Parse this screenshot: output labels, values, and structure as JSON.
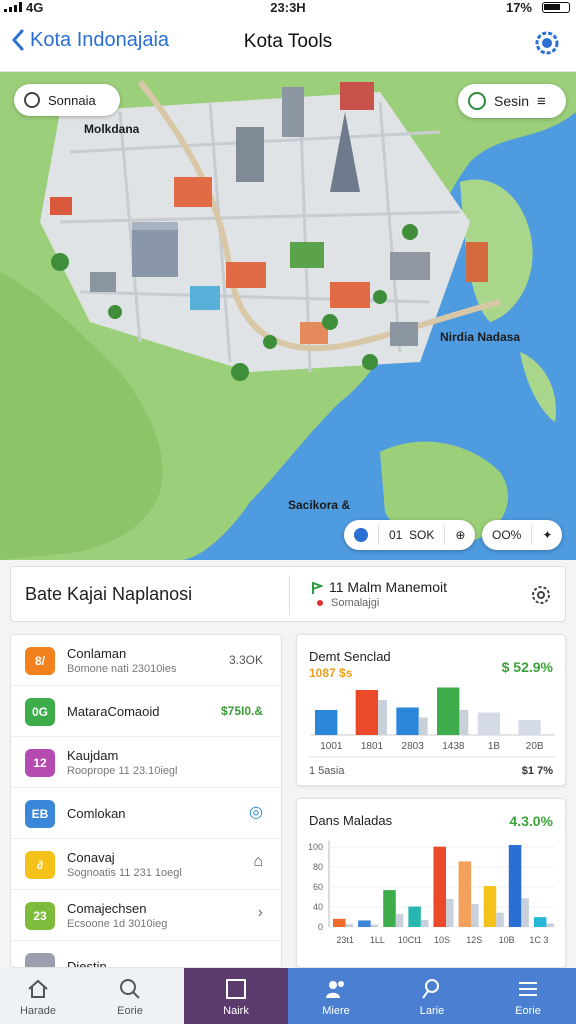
{
  "status": {
    "left": "4G",
    "time": "23:3H",
    "right": "17%"
  },
  "header": {
    "back_label": "Kota Indonajaia",
    "title": "Kota Tools"
  },
  "map": {
    "search_chip": "Sonnaia",
    "session_chip": "Sesin",
    "labels": {
      "north_west": "Molkdana",
      "east": "Nirdia Nadasa",
      "south": "Sacikora &"
    },
    "controls": {
      "count": "01",
      "unit": "SOK",
      "zoom": "OO%"
    }
  },
  "summary": {
    "title": "Bate Kajai Naplanosi",
    "metric": "11 Malm Manemoit",
    "metric_sub": "Somalajgi"
  },
  "list": [
    {
      "badge": "8/",
      "color": "#f2811d",
      "name": "Conlaman",
      "sub": "Bomone nati 23010ies",
      "value": "3.3OK"
    },
    {
      "badge": "0G",
      "color": "#3cad4a",
      "name": "MataraComaoid",
      "sub": "",
      "value": "$75I0.&",
      "value_color": "#3a9a3a"
    },
    {
      "badge": "12",
      "color": "#b54bb0",
      "name": "Kaujdam",
      "sub": "Rooprope 11 23.10iegl",
      "value": ""
    },
    {
      "badge": "EB",
      "color": "#3a86d8",
      "name": "Comlokan",
      "sub": "",
      "value": ""
    },
    {
      "badge": "∂",
      "color": "#f5c21b",
      "name": "Conavaj",
      "sub": "Sognoatis 11 231 1oegl",
      "value": ""
    },
    {
      "badge": "23",
      "color": "#7cbb3b",
      "name": "Comajechsen",
      "sub": "Ecsoone 1d 3010ieg",
      "value": ""
    },
    {
      "badge": "",
      "color": "#9aa0b0",
      "name": "Diestin",
      "sub": "",
      "value": ""
    }
  ],
  "chart1_card": {
    "title": "Demt Senclad",
    "value": "$ 52.9%",
    "sub": "1087 $s",
    "footer_left": "1 5asia",
    "footer_right": "$1 7%"
  },
  "chart2_card": {
    "title": "Dans Maladas",
    "value": "4.3.0%"
  },
  "chart_data": [
    {
      "type": "bar",
      "title": "Demt Senclad",
      "categories": [
        "1001",
        "1801",
        "2803",
        "1438",
        "1B",
        "20B"
      ],
      "series": [
        {
          "values": [
            20,
            36,
            22,
            38,
            18,
            12
          ]
        },
        {
          "values": [
            0,
            28,
            14,
            20,
            0,
            0
          ]
        }
      ]
    },
    {
      "type": "bar",
      "title": "Dans Maladas",
      "categories": [
        "23t1",
        "1LL",
        "10Ct1",
        "10S",
        "12S",
        "10B",
        "1C 3"
      ],
      "yticks": [
        "100",
        "80",
        "60",
        "40",
        "0"
      ],
      "ylim": [
        0,
        100
      ],
      "series": [
        {
          "values": [
            10,
            8,
            45,
            25,
            98,
            80,
            50,
            100,
            12
          ]
        }
      ],
      "bar_colors": [
        "#f06b2a",
        "#3b86d8",
        "#3cad4a",
        "#2ab6b0",
        "#ea4a2a",
        "#f2a05a",
        "#f5c21b",
        "#2a6fd1",
        "#27b8d8"
      ]
    }
  ],
  "tabs": [
    {
      "label": "Harade",
      "bg": "#eef1f6",
      "fg": "#555",
      "icon": "home-icon"
    },
    {
      "label": "Eorie",
      "bg": "#eef1f6",
      "fg": "#555",
      "icon": "search-icon"
    },
    {
      "label": "Nairk",
      "bg": "#5b3a6e",
      "fg": "#ffffff",
      "icon": "square-icon"
    },
    {
      "label": "Miere",
      "bg": "#4a7fd1",
      "fg": "#ffffff",
      "icon": "people-icon"
    },
    {
      "label": "Larie",
      "bg": "#4a7fd1",
      "fg": "#ffffff",
      "icon": "pin-icon"
    },
    {
      "label": "Eorie",
      "bg": "#4a7fd1",
      "fg": "#ffffff",
      "icon": "menu-icon"
    }
  ]
}
